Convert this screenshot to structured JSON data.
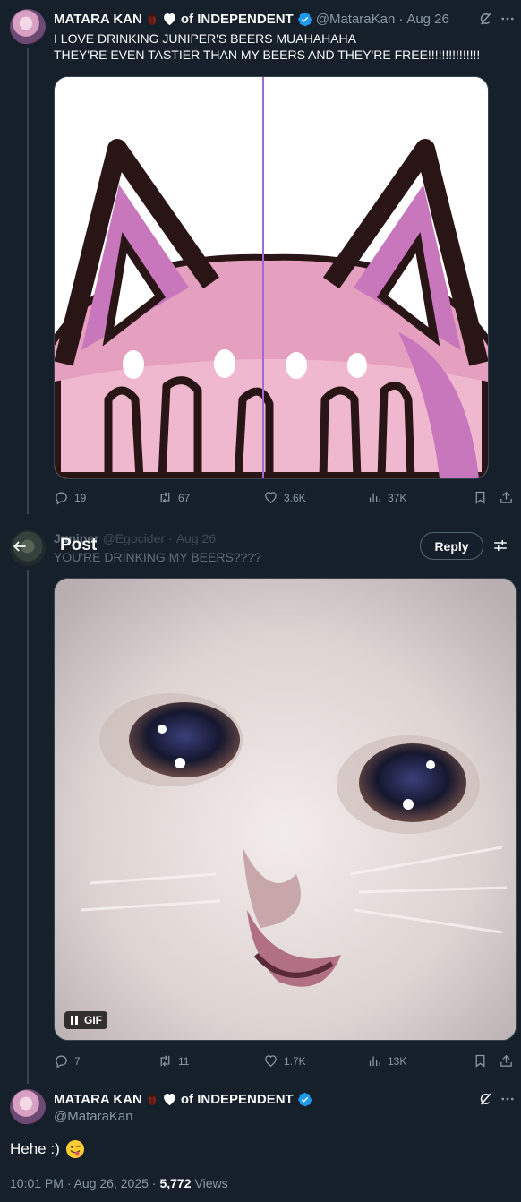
{
  "tweet1": {
    "name": "MATARA KAN",
    "name_suffix": "of INDEPENDENT",
    "handle": "@MataraKan",
    "date": "Aug 26",
    "line1": "I LOVE DRINKING JUNIPER'S BEERS MUAHAHAHA",
    "line2": "THEY'RE EVEN TASTIER THAN MY BEERS AND THEY'RE FREE!!!!!!!!!!!!!!!",
    "replies": "19",
    "reposts": "67",
    "likes": "3.6K",
    "views": "37K"
  },
  "header": {
    "title": "Post",
    "reply_label": "Reply"
  },
  "tweet2": {
    "name": "Juniper",
    "handle": "@Egocider",
    "date": "Aug 26",
    "text": "YOU'RE DRINKING MY BEERS????",
    "gif_label": "GIF",
    "replies": "7",
    "reposts": "11",
    "likes": "1.7K",
    "views": "13K"
  },
  "tweet3": {
    "name": "MATARA KAN",
    "name_suffix": "of INDEPENDENT",
    "handle": "@MataraKan",
    "text": "Hehe :)",
    "time": "10:01 PM · Aug 26, 2025 ·",
    "views_count": "5,772",
    "views_label": "Views"
  },
  "icons": {
    "reply": "reply-icon",
    "repost": "repost-icon",
    "like": "heart-icon",
    "views": "views-icon",
    "bookmark": "bookmark-icon",
    "share": "share-icon",
    "grok": "grok-icon",
    "more": "more-icon",
    "back": "back-arrow-icon",
    "filter": "sliders-icon",
    "pause": "pause-icon"
  },
  "colors": {
    "background": "#15202b",
    "muted": "#8b98a5",
    "verified": "#1d9bf0",
    "border": "#38444d"
  }
}
